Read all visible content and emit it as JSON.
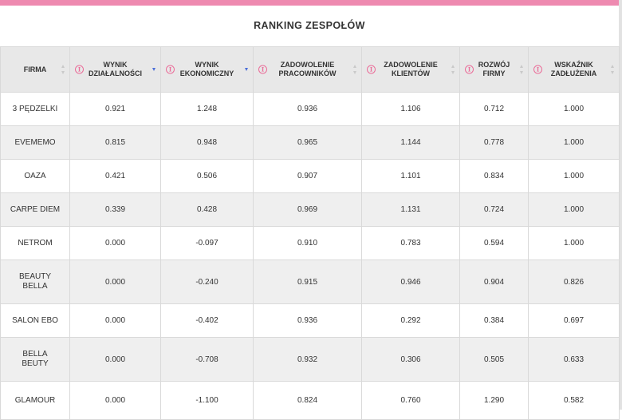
{
  "title": "RANKING ZESPOŁÓW",
  "colors": {
    "accent_bar": "#ee8ab0",
    "info_icon": "#ea6d99",
    "sort_active": "#4b6fd8",
    "row_alt": "#efefef"
  },
  "columns": [
    {
      "label": "FIRMA",
      "info": false,
      "sort": "none"
    },
    {
      "label": "WYNIK DZIAŁALNOŚCI",
      "line1": "WYNIK",
      "line2": "DZIAŁALNOŚCI",
      "info": true,
      "sort": "desc"
    },
    {
      "label": "WYNIK EKONOMICZNY",
      "line1": "WYNIK",
      "line2": "EKONOMICZNY",
      "info": true,
      "sort": "desc"
    },
    {
      "label": "ZADOWOLENIE PRACOWNIKÓW",
      "line1": "ZADOWOLENIE",
      "line2": "PRACOWNIKÓW",
      "info": true,
      "sort": "both"
    },
    {
      "label": "ZADOWOLENIE KLIENTÓW",
      "line1": "ZADOWOLENIE",
      "line2": "KLIENTÓW",
      "info": true,
      "sort": "both"
    },
    {
      "label": "ROZWÓJ FIRMY",
      "line1": "ROZWÓJ",
      "line2": "FIRMY",
      "info": true,
      "sort": "both"
    },
    {
      "label": "WSKAŹNIK ZADŁUŻENIA",
      "line1": "WSKAŹNIK",
      "line2": "ZADŁUŻENIA",
      "info": true,
      "sort": "both"
    }
  ],
  "info_glyph": "i",
  "rows": [
    {
      "firma": "3 PĘDZELKI",
      "firma_line1": "3 PĘDZELKI",
      "firma_line2": "",
      "values": [
        "0.921",
        "1.248",
        "0.936",
        "1.106",
        "0.712",
        "1.000"
      ]
    },
    {
      "firma": "EVEMEMO",
      "firma_line1": "EVEMEMO",
      "firma_line2": "",
      "values": [
        "0.815",
        "0.948",
        "0.965",
        "1.144",
        "0.778",
        "1.000"
      ]
    },
    {
      "firma": "OAZA",
      "firma_line1": "OAZA",
      "firma_line2": "",
      "values": [
        "0.421",
        "0.506",
        "0.907",
        "1.101",
        "0.834",
        "1.000"
      ]
    },
    {
      "firma": "CARPE DIEM",
      "firma_line1": "CARPE DIEM",
      "firma_line2": "",
      "values": [
        "0.339",
        "0.428",
        "0.969",
        "1.131",
        "0.724",
        "1.000"
      ]
    },
    {
      "firma": "NETROM",
      "firma_line1": "NETROM",
      "firma_line2": "",
      "values": [
        "0.000",
        "-0.097",
        "0.910",
        "0.783",
        "0.594",
        "1.000"
      ]
    },
    {
      "firma": "BEAUTY BELLA",
      "firma_line1": "BEAUTY",
      "firma_line2": "BELLA",
      "values": [
        "0.000",
        "-0.240",
        "0.915",
        "0.946",
        "0.904",
        "0.826"
      ]
    },
    {
      "firma": "SALON EBO",
      "firma_line1": "SALON EBO",
      "firma_line2": "",
      "values": [
        "0.000",
        "-0.402",
        "0.936",
        "0.292",
        "0.384",
        "0.697"
      ]
    },
    {
      "firma": "BELLA BEUTY",
      "firma_line1": "BELLA",
      "firma_line2": "BEUTY",
      "values": [
        "0.000",
        "-0.708",
        "0.932",
        "0.306",
        "0.505",
        "0.633"
      ]
    },
    {
      "firma": "GLAMOUR",
      "firma_line1": "GLAMOUR",
      "firma_line2": "",
      "values": [
        "0.000",
        "-1.100",
        "0.824",
        "0.760",
        "1.290",
        "0.582"
      ]
    }
  ]
}
